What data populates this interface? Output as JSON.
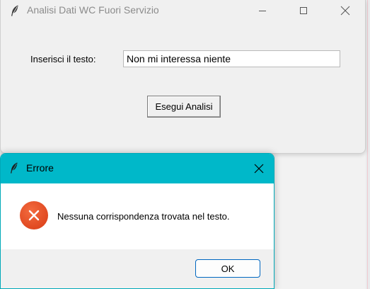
{
  "main_window": {
    "title": "Analisi Dati WC Fuori Servizio",
    "input_label": "Inserisci il testo:",
    "input_value": "Non mi interessa niente",
    "analyze_button": "Esegui Analisi"
  },
  "error_dialog": {
    "title": "Errore",
    "message": "Nessuna corrispondenza trovata nel testo.",
    "ok_button": "OK"
  },
  "icons": {
    "app_icon": "feather-icon",
    "error_icon": "error-x-icon"
  },
  "colors": {
    "dialog_titlebar": "#00b8c9",
    "error_icon": "#e4491f",
    "ok_border": "#0067c0"
  }
}
